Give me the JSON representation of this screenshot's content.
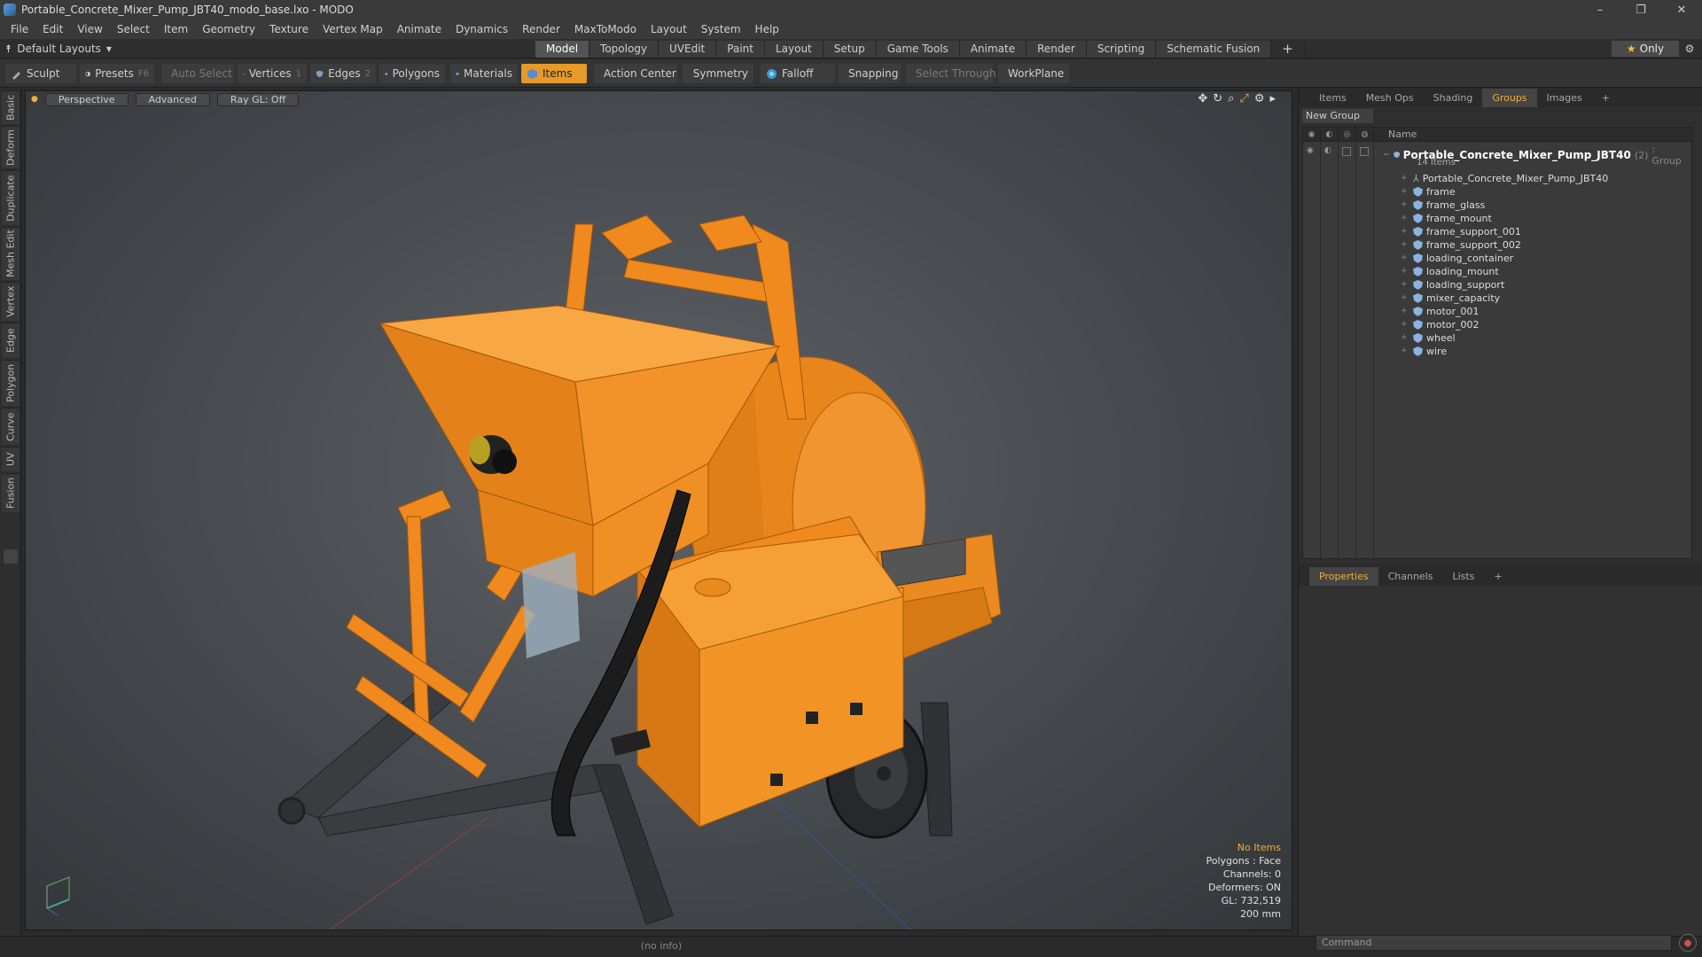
{
  "window": {
    "title": "Portable_Concrete_Mixer_Pump_JBT40_modo_base.lxo - MODO",
    "controls": [
      "–",
      "❐",
      "✕"
    ]
  },
  "menu": [
    "File",
    "Edit",
    "View",
    "Select",
    "Item",
    "Geometry",
    "Texture",
    "Vertex Map",
    "Animate",
    "Dynamics",
    "Render",
    "MaxToModo",
    "Layout",
    "System",
    "Help"
  ],
  "layouts": {
    "label": "Default Layouts"
  },
  "tabs": [
    {
      "label": "Model",
      "active": true
    },
    {
      "label": "Topology"
    },
    {
      "label": "UVEdit"
    },
    {
      "label": "Paint"
    },
    {
      "label": "Layout"
    },
    {
      "label": "Setup"
    },
    {
      "label": "Game Tools"
    },
    {
      "label": "Animate"
    },
    {
      "label": "Render"
    },
    {
      "label": "Scripting"
    },
    {
      "label": "Schematic Fusion"
    }
  ],
  "tab_plus": "+",
  "only": {
    "label": "Only",
    "star": "★"
  },
  "toolbar": {
    "sculpt": "Sculpt",
    "presets": "Presets",
    "presets_key": "F6",
    "auto_select": "Auto Select",
    "vertices": "Vertices",
    "vertices_key": "1",
    "edges": "Edges",
    "edges_key": "2",
    "polygons": "Polygons",
    "materials": "Materials",
    "items": "Items",
    "action_center": "Action Center",
    "symmetry": "Symmetry",
    "falloff": "Falloff",
    "snapping": "Snapping",
    "select_through": "Select Through",
    "workplane": "WorkPlane"
  },
  "left_tabs": [
    "Basic",
    "Deform",
    "Duplicate",
    "Mesh Edit",
    "Vertex",
    "Edge",
    "Polygon",
    "Curve",
    "UV",
    "Fusion"
  ],
  "viewport": {
    "perspective": "Perspective",
    "advanced": "Advanced",
    "raygl": "Ray GL: Off",
    "stats": {
      "no_items": "No Items",
      "polygons": "Polygons : Face",
      "channels": "Channels: 0",
      "deformers": "Deformers: ON",
      "gl": "GL: 732,519",
      "scale": "200 mm"
    }
  },
  "panel_tabs": [
    {
      "label": "Items"
    },
    {
      "label": "Mesh Ops"
    },
    {
      "label": "Shading"
    },
    {
      "label": "Groups",
      "active": true
    },
    {
      "label": "Images"
    },
    {
      "label": "+"
    }
  ],
  "groups": {
    "new_group": "New Group",
    "name_col": "Name",
    "root_name": "Portable_Concrete_Mixer_Pump_JBT40",
    "root_count": "(2)",
    "root_type": ": Group",
    "root_sub": "14 Items",
    "items": [
      "Portable_Concrete_Mixer_Pump_JBT40",
      "frame",
      "frame_glass",
      "frame_mount",
      "frame_support_001",
      "frame_support_002",
      "loading_container",
      "loading_mount",
      "loading_support",
      "mixer_capacity",
      "motor_001",
      "motor_002",
      "wheel",
      "wire"
    ]
  },
  "props_tabs": [
    {
      "label": "Properties",
      "active": true
    },
    {
      "label": "Channels"
    },
    {
      "label": "Lists"
    },
    {
      "label": "+"
    }
  ],
  "status": {
    "info": "(no info)",
    "command_placeholder": "Command"
  },
  "colors": {
    "accent": "#e59a2a",
    "highlight": "#f0b030",
    "model_orange": "#f08a1e"
  }
}
